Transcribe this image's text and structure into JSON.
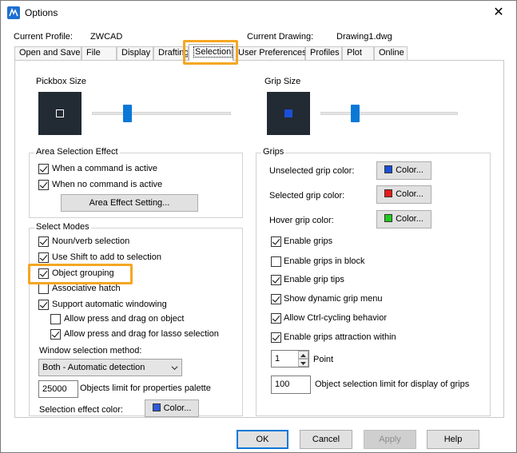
{
  "window": {
    "title": "Options",
    "close_glyph": "✕"
  },
  "profile": {
    "current_profile_label": "Current Profile:",
    "current_profile_value": "ZWCAD",
    "current_drawing_label": "Current Drawing:",
    "current_drawing_value": "Drawing1.dwg"
  },
  "tabs": [
    {
      "label": "Open and Save"
    },
    {
      "label": "File"
    },
    {
      "label": "Display"
    },
    {
      "label": "Drafting"
    },
    {
      "label": "Selection",
      "active": true
    },
    {
      "label": "User Preferences"
    },
    {
      "label": "Profiles"
    },
    {
      "label": "Plot"
    },
    {
      "label": "Online"
    }
  ],
  "pickbox": {
    "title": "Pickbox Size",
    "slider_level": 0.25
  },
  "grip_size": {
    "title": "Grip Size",
    "slider_level": 0.25,
    "preview_color": "#1a4fd8"
  },
  "area_selection": {
    "title": "Area Selection Effect",
    "when_active": {
      "label": "When a command is active",
      "checked": true
    },
    "when_no_command": {
      "label": "When no command is active",
      "checked": true
    },
    "setting_button": "Area Effect Setting..."
  },
  "select_modes": {
    "title": "Select Modes",
    "noun_verb": {
      "label": "Noun/verb selection",
      "checked": true
    },
    "use_shift": {
      "label": "Use Shift to add to selection",
      "checked": true
    },
    "object_grouping": {
      "label": "Object grouping",
      "checked": true
    },
    "associative_hatch": {
      "label": "Associative hatch",
      "checked": false
    },
    "auto_windowing": {
      "label": "Support automatic windowing",
      "checked": true
    },
    "press_drag_object": {
      "label": "Allow press and drag on object",
      "checked": false
    },
    "press_drag_lasso": {
      "label": "Allow press and drag for lasso selection",
      "checked": true
    },
    "window_method_label": "Window selection method:",
    "window_method_value": "Both - Automatic detection",
    "objects_limit_value": "25000",
    "objects_limit_label": "Objects limit for properties palette",
    "effect_color_label": "Selection effect color:",
    "effect_color_button": "Color...",
    "effect_color_hex": "#2f5bd8"
  },
  "grips": {
    "title": "Grips",
    "unselected_label": "Unselected grip color:",
    "unselected_color": "#1a4fd8",
    "selected_label": "Selected grip color:",
    "selected_color": "#e81a1a",
    "hover_label": "Hover grip color:",
    "hover_color": "#22c922",
    "color_button": "Color...",
    "enable_grips": {
      "label": "Enable grips",
      "checked": true
    },
    "enable_in_block": {
      "label": "Enable grips in block",
      "checked": false
    },
    "enable_tips": {
      "label": "Enable grip tips",
      "checked": true
    },
    "dynamic_menu": {
      "label": "Show dynamic grip menu",
      "checked": true
    },
    "ctrl_cycling": {
      "label": "Allow Ctrl-cycling behavior",
      "checked": true
    },
    "attraction": {
      "label": "Enable grips attraction within",
      "checked": true
    },
    "point_value": "1",
    "point_label": "Point",
    "limit_value": "100",
    "limit_label": "Object selection limit for display of grips"
  },
  "footer": {
    "ok": "OK",
    "cancel": "Cancel",
    "apply": "Apply",
    "help": "Help"
  }
}
